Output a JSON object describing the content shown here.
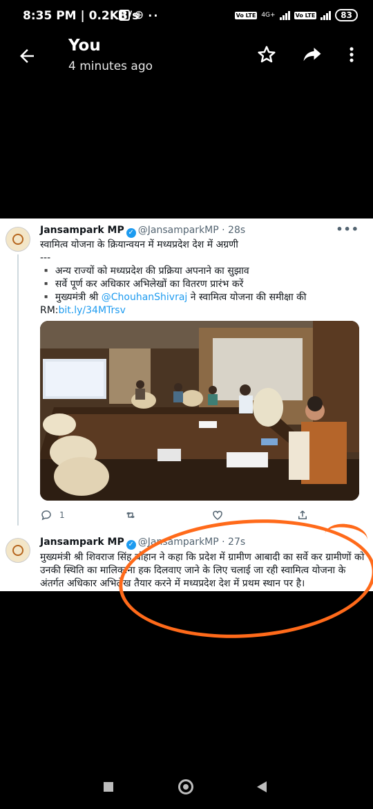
{
  "status_bar": {
    "time": "8:35 PM",
    "data_rate": "0.2KB/s",
    "dots": "··",
    "network": "4G+",
    "volte1": "Vo LTE",
    "volte2": "Vo LTE",
    "battery": "83"
  },
  "app_bar": {
    "title": "You",
    "subtitle": "4 minutes ago",
    "icons": [
      "back-arrow-icon",
      "star-icon",
      "share-icon",
      "more-vert-icon"
    ]
  },
  "tweets": [
    {
      "name": "Jansampark MP",
      "handle": "@JansamparkMP",
      "time": "· 28s",
      "lines": [
        "स्वामित्व योजना के क्रियान्वयन में मध्यप्रदेश देश में अग्रणी",
        "---",
        "▪️ अन्य राज्यों को मध्यप्रदेश की प्रक्रिया अपनाने का सुझाव",
        "▪️ सर्वे पूर्ण कर अधिकार अभिलेखों का वितरण प्रारंभ करें",
        "▪️ मुख्यमंत्री श्री",
        "ने स्वामित्व योजना की समीक्षा की"
      ],
      "mention": "@ChouhanShivraj",
      "rm_prefix": "RM:",
      "link": "bit.ly/34MTrsv",
      "reply_count": "1"
    },
    {
      "name": "Jansampark MP",
      "handle": "@JansamparkMP",
      "time": "· 27s",
      "text": "मुख्यमंत्री श्री शिवराज सिंह चौहान ने कहा कि प्रदेश में ग्रामीण आबादी का सर्वे कर ग्रामीणों को उनकी स्थिति का मालिकाना हक दिलवाए जाने के लिए चलाई जा रही स्वामित्व योजना के अंतर्गत अधिकार अभिलेख तैयार करने में मध्यप्रदेश देश में प्रथम स्थान पर है।"
    }
  ],
  "annotation_color": "#ff6a1a",
  "accent": "#1d9bf0"
}
